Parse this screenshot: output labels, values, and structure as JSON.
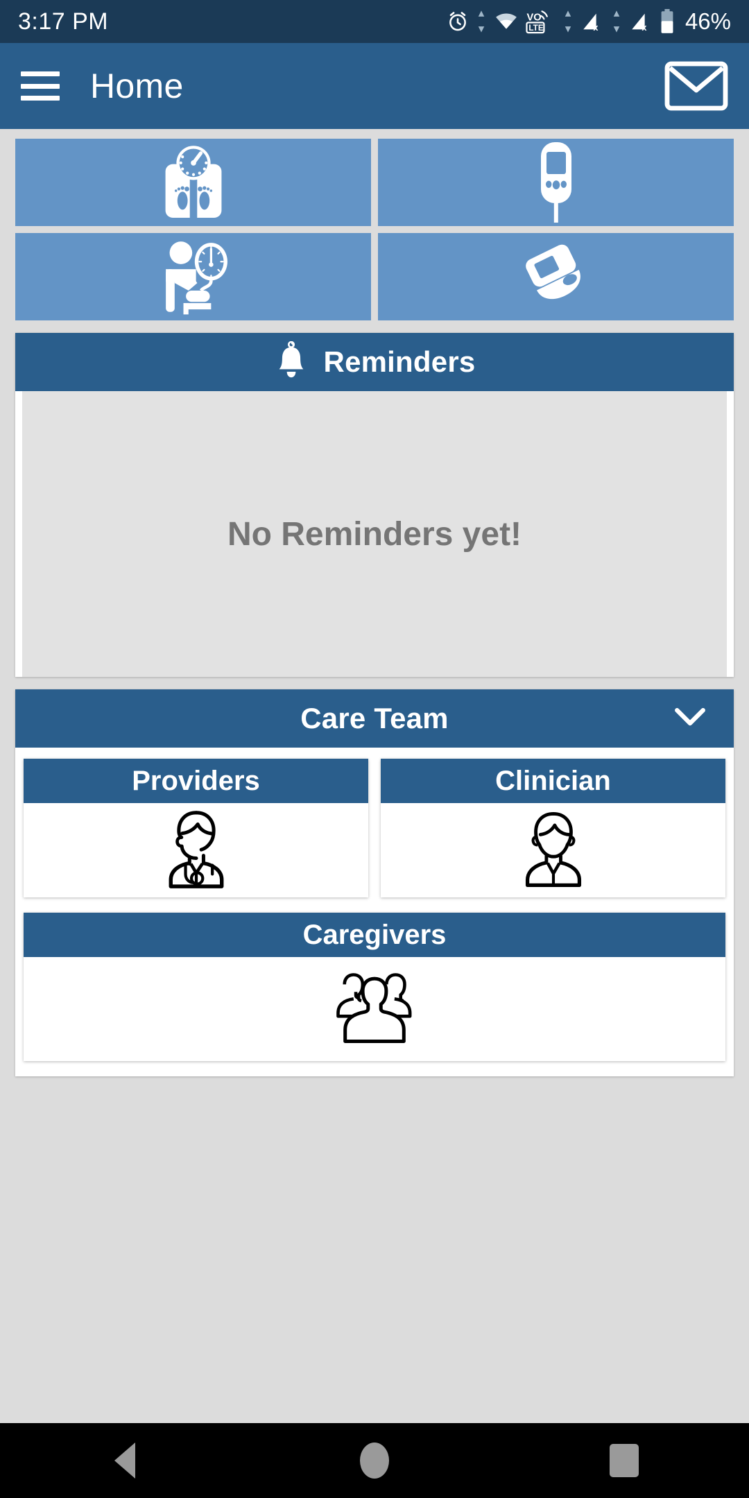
{
  "status_bar": {
    "time": "3:17 PM",
    "battery_percent": "46%",
    "icons": [
      "alarm-icon",
      "data-transfer-icon",
      "wifi-icon",
      "volte-icon",
      "data-transfer-icon",
      "signal-no-sim-icon",
      "signal-no-sim-icon",
      "battery-icon"
    ]
  },
  "app_bar": {
    "menu_icon": "hamburger-menu-icon",
    "title": "Home",
    "mail_icon": "envelope-icon"
  },
  "tiles": [
    {
      "name": "weight-scale-tile",
      "icon": "weight-scale-icon"
    },
    {
      "name": "glucometer-tile",
      "icon": "glucometer-icon"
    },
    {
      "name": "blood-pressure-tile",
      "icon": "blood-pressure-icon"
    },
    {
      "name": "pulse-oximeter-tile",
      "icon": "pulse-oximeter-icon"
    }
  ],
  "reminders": {
    "icon": "bell-icon",
    "title": "Reminders",
    "empty_message": "No Reminders yet!"
  },
  "care_team": {
    "title": "Care Team",
    "expand_icon": "chevron-down-icon",
    "cards": [
      {
        "label": "Providers",
        "icon": "doctor-icon"
      },
      {
        "label": "Clinician",
        "icon": "clinician-icon"
      },
      {
        "label": "Caregivers",
        "icon": "group-people-icon"
      }
    ]
  },
  "nav_bar": {
    "back": "back-triangle-icon",
    "home": "home-circle-icon",
    "recents": "recents-square-icon"
  },
  "colors": {
    "status_bar": "#1b3a56",
    "app_bar": "#2a5e8c",
    "tile": "#6394c6",
    "page_bg": "#dcdcdc",
    "empty_text": "#757575",
    "card_header": "#2a5e8c"
  }
}
